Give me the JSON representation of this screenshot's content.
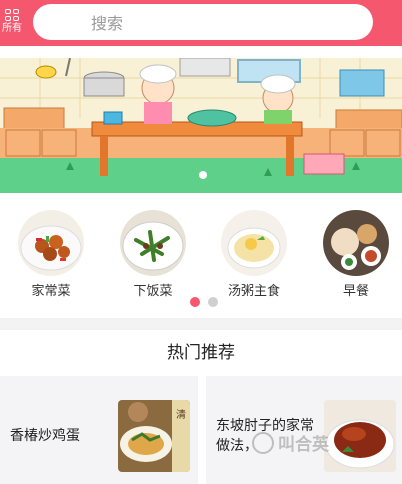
{
  "header": {
    "all_label": "所有",
    "search_placeholder": "搜索"
  },
  "categories": [
    {
      "label": "家常菜"
    },
    {
      "label": "下饭菜"
    },
    {
      "label": "汤粥主食"
    },
    {
      "label": "早餐"
    }
  ],
  "pager": {
    "pages": 2,
    "active": 1
  },
  "section": {
    "title": "热门推荐"
  },
  "recommendations": [
    {
      "title": "香椿炒鸡蛋",
      "image_text": "清"
    },
    {
      "title_line1": "东坡肘子的家常",
      "title_line2": "做法，"
    }
  ],
  "watermark": {
    "text": "叫合英"
  },
  "colors": {
    "brand": "#f5576e",
    "pager_inactive": "#cfcfcf"
  }
}
